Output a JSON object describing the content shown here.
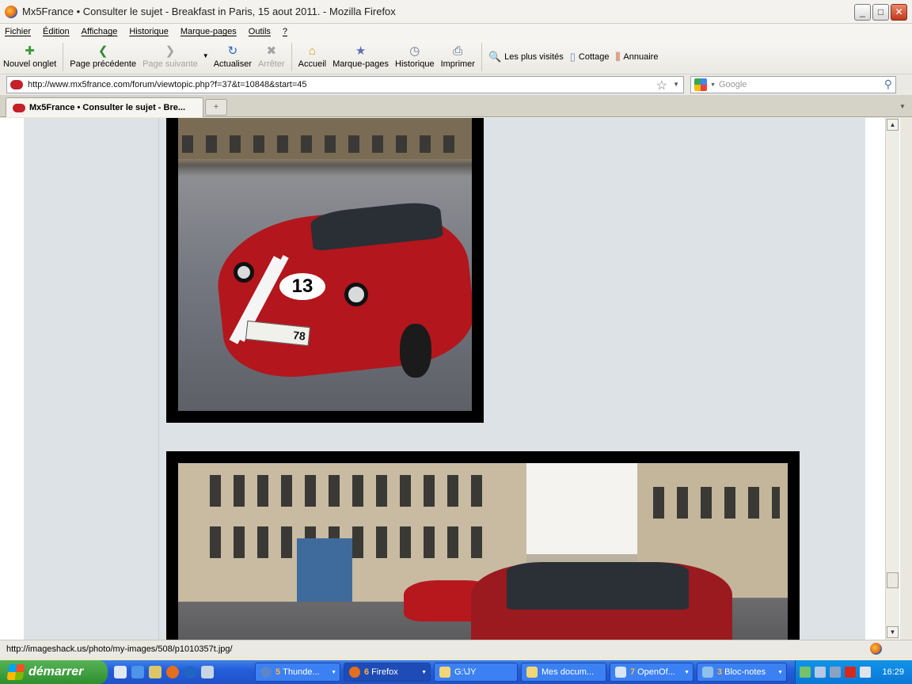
{
  "window": {
    "title": "Mx5France • Consulter le sujet - Breakfast in Paris, 15 aout 2011. - Mozilla Firefox",
    "buttons": [
      "minimize",
      "maximize",
      "close"
    ]
  },
  "menu": [
    "Fichier",
    "Édition",
    "Affichage",
    "Historique",
    "Marque-pages",
    "Outils",
    "?"
  ],
  "toolbar": {
    "new_tab": "Nouvel onglet",
    "back": "Page précédente",
    "forward": "Page suivante",
    "reload": "Actualiser",
    "stop": "Arrêter",
    "home": "Accueil",
    "bookmarks": "Marque-pages",
    "history": "Historique",
    "print": "Imprimer"
  },
  "bookmarks_bar": [
    "Les plus visités",
    "Cottage",
    "Annuaire"
  ],
  "address": {
    "url": "http://www.mx5france.com/forum/viewtopic.php?f=37&t=10848&start=45"
  },
  "search": {
    "placeholder": "Google"
  },
  "tab": {
    "label": "Mx5France • Consulter le sujet - Bre..."
  },
  "content": {
    "photo1": {
      "plate": "78",
      "race_number": "13"
    }
  },
  "status": {
    "text": "http://imageshack.us/photo/my-images/508/p1010357t.jpg/"
  },
  "taskbar": {
    "start": "démarrer",
    "tasks": [
      {
        "count": "5",
        "label": "Thunde..."
      },
      {
        "count": "6",
        "label": "Firefox"
      },
      {
        "count": "",
        "label": "G:\\JY"
      },
      {
        "count": "",
        "label": "Mes docum..."
      },
      {
        "count": "7",
        "label": "OpenOf..."
      },
      {
        "count": "3",
        "label": "Bloc-notes"
      }
    ],
    "clock": "16:29"
  }
}
